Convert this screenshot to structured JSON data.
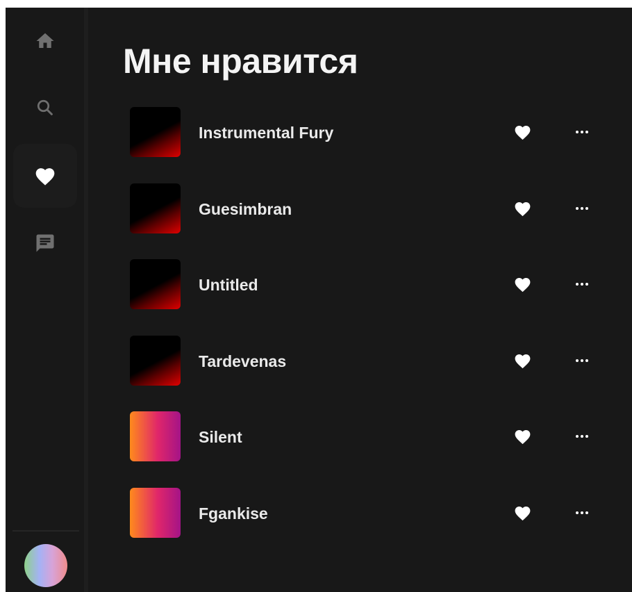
{
  "sidebar": {
    "items": [
      {
        "name": "home",
        "icon": "home-icon",
        "active": false
      },
      {
        "name": "search",
        "icon": "search-icon",
        "active": false
      },
      {
        "name": "liked",
        "icon": "heart-icon",
        "active": true
      },
      {
        "name": "messages",
        "icon": "chat-icon",
        "active": false
      }
    ],
    "avatar": {
      "icon": "user-avatar"
    }
  },
  "page": {
    "title": "Мне нравится"
  },
  "tracks": [
    {
      "title": "Instrumental Fury",
      "cover": "dark-red-gradient",
      "liked": true
    },
    {
      "title": "Guesimbran",
      "cover": "dark-red-gradient",
      "liked": true
    },
    {
      "title": "Untitled",
      "cover": "dark-red-gradient",
      "liked": true
    },
    {
      "title": "Tardevenas",
      "cover": "dark-red-gradient",
      "liked": true
    },
    {
      "title": "Silent",
      "cover": "orange-purple-gradient",
      "liked": true
    },
    {
      "title": "Fgankise",
      "cover": "orange-purple-gradient",
      "liked": true
    }
  ],
  "colors": {
    "background": "#181818",
    "text": "#eaeaea",
    "icon_inactive": "#6f6f6f",
    "icon_active": "#ffffff",
    "cover_dark_accent": "#e00000",
    "cover_warm_start": "#ff8a1c",
    "cover_warm_end": "#a41487"
  }
}
